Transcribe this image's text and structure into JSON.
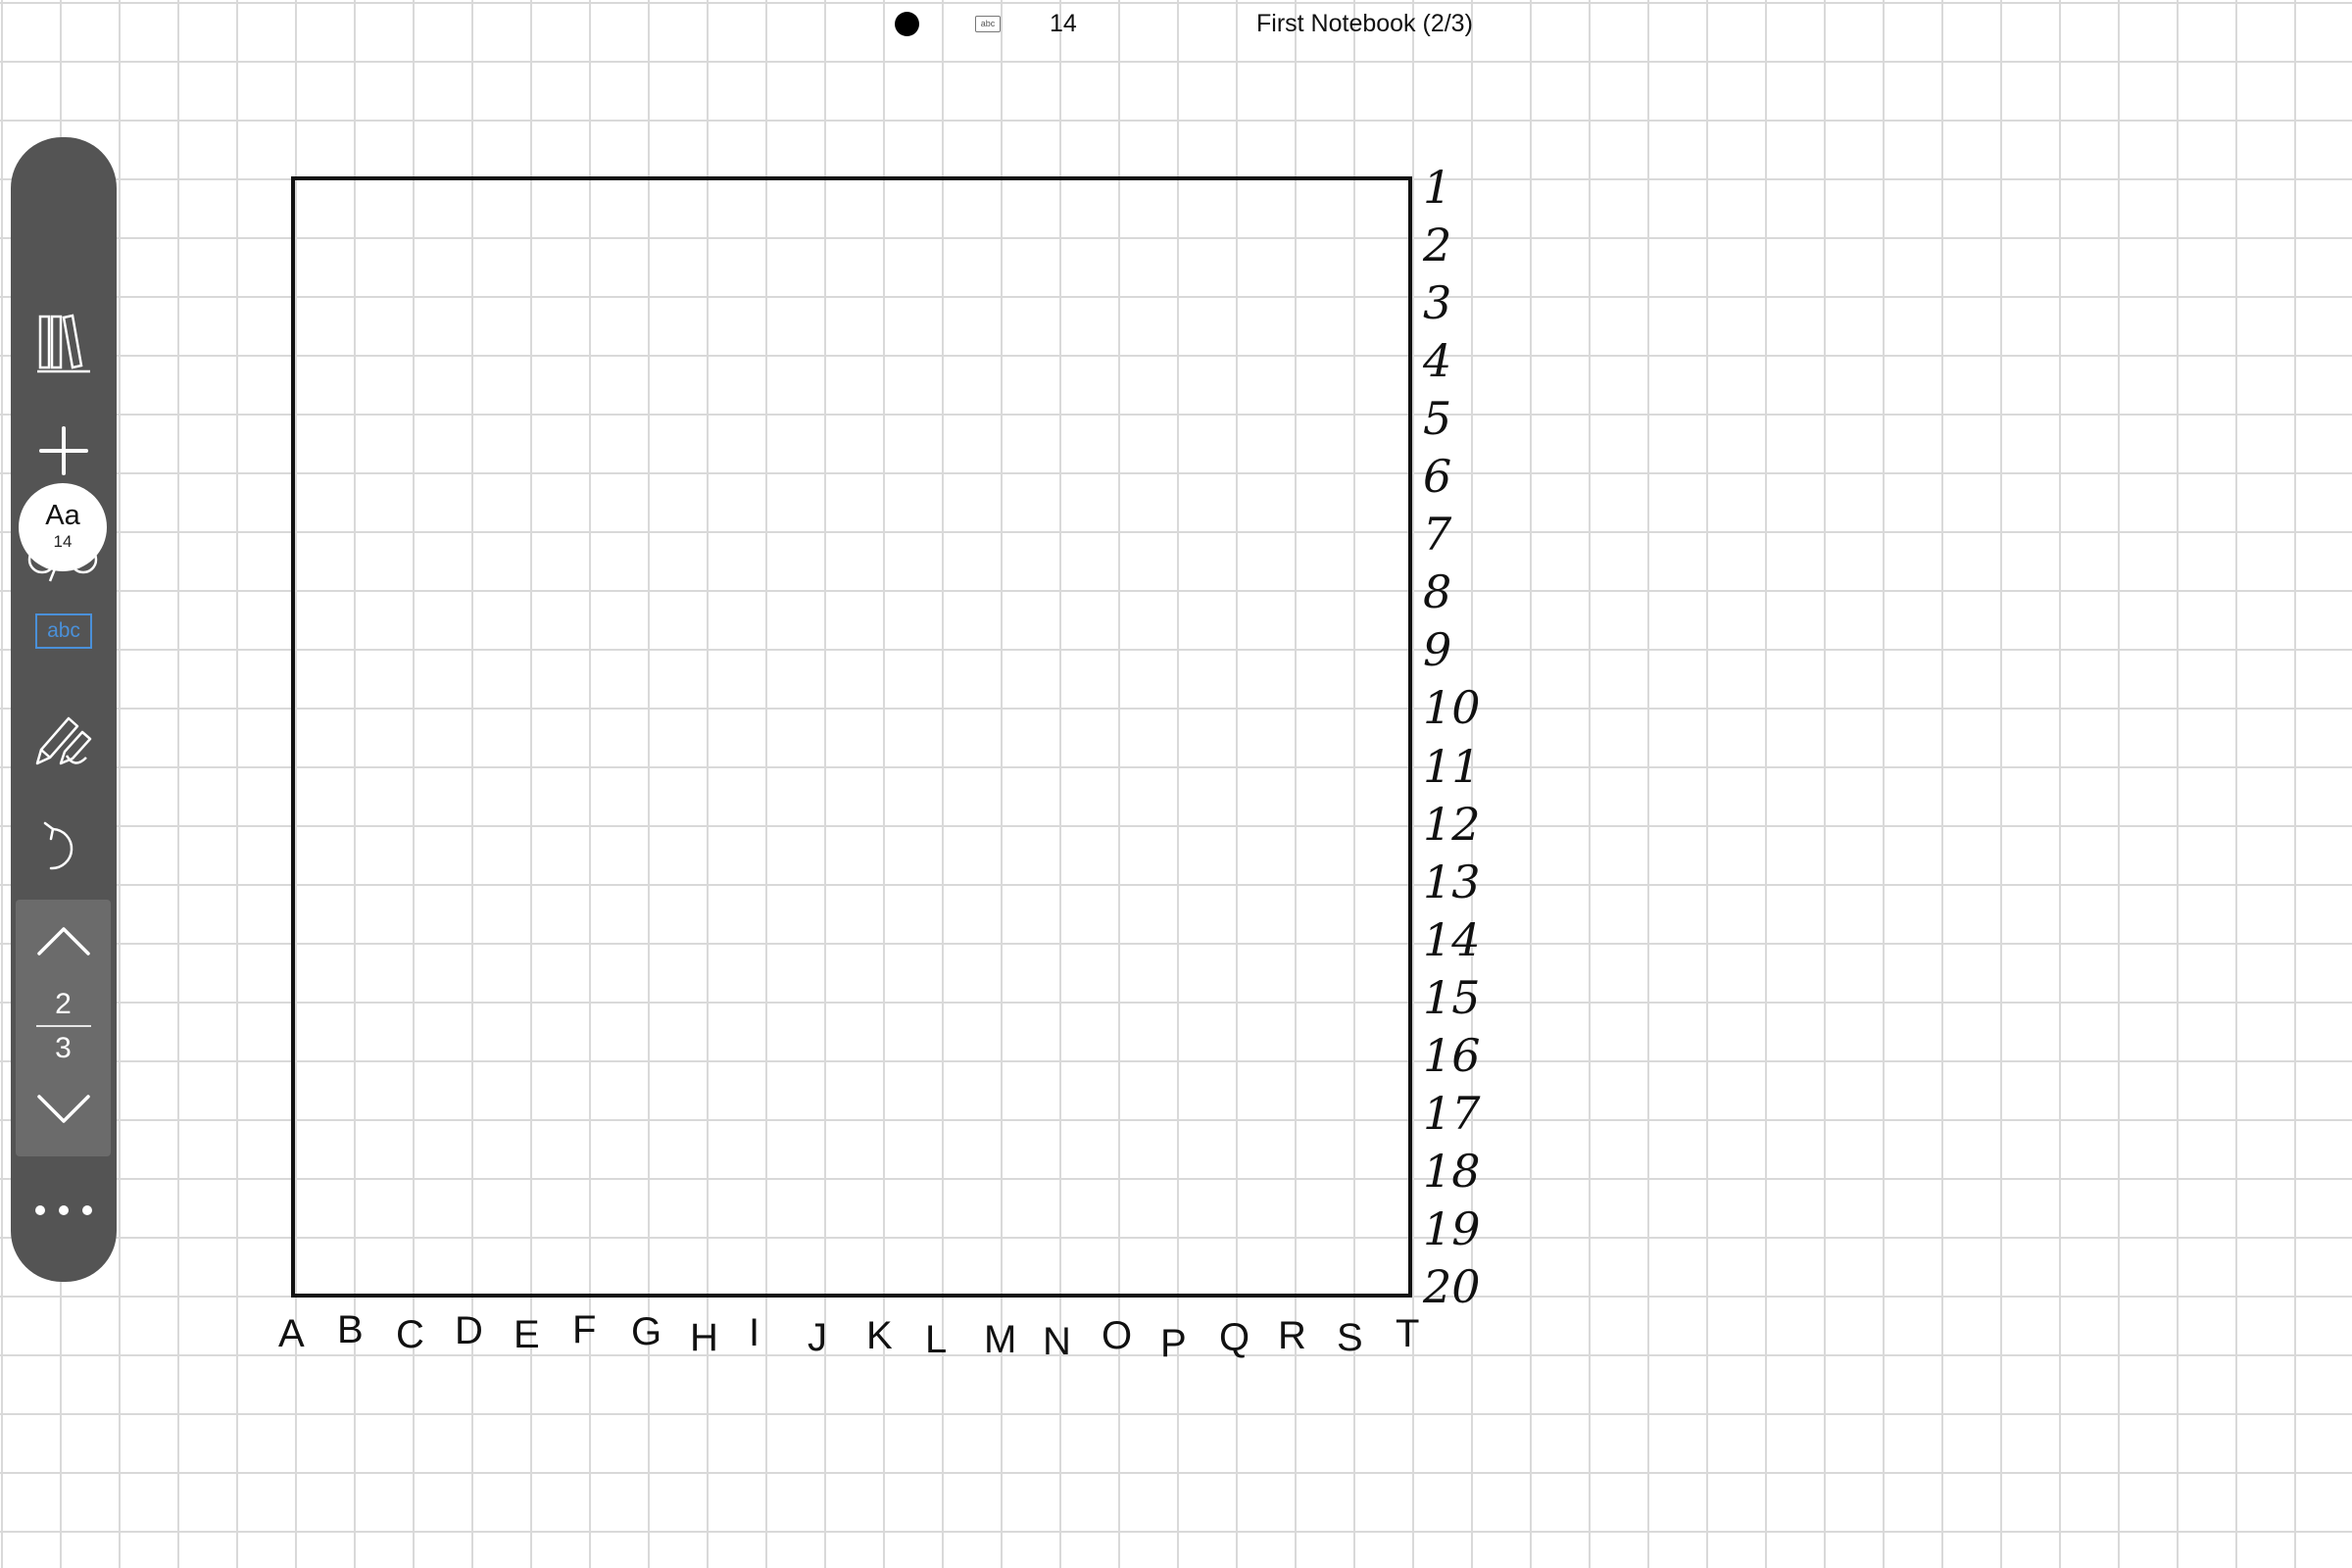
{
  "status_bar": {
    "pen_color": "#000000",
    "abc_label": "abc",
    "font_size": "14",
    "notebook_title": "First Notebook (2/3)"
  },
  "toolbar": {
    "library_icon": "books-icon",
    "add_icon": "plus-icon",
    "view_icon": "glasses-icon",
    "font_button": {
      "label": "Aa",
      "size": "14"
    },
    "text_box_label": "abc",
    "pen_icon": "pen-pencil-icon",
    "undo_icon": "undo-icon",
    "pager": {
      "current": "2",
      "total": "3"
    },
    "more_icon": "more-dots-icon",
    "colors": {
      "toolbar_bg": "#545454",
      "pager_bg": "#6b6b6b",
      "accent": "#4a90d9"
    }
  },
  "board": {
    "row_labels": [
      "1",
      "2",
      "3",
      "4",
      "5",
      "6",
      "7",
      "8",
      "9",
      "10",
      "11",
      "12",
      "13",
      "14",
      "15",
      "16",
      "17",
      "18",
      "19",
      "20"
    ],
    "col_labels": [
      "A",
      "B",
      "C",
      "D",
      "E",
      "F",
      "G",
      "H",
      "I",
      "J",
      "K",
      "L",
      "M",
      "N",
      "O",
      "P",
      "Q",
      "R",
      "S",
      "T"
    ]
  }
}
